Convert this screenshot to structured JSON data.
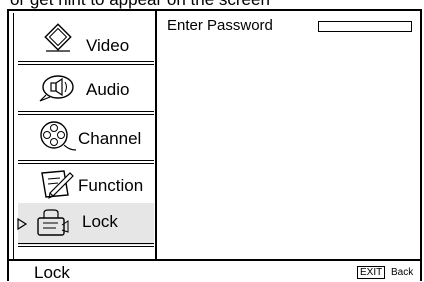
{
  "top_banner": "or get hint to appear on the screen",
  "menu": [
    {
      "label": "Video",
      "icon": "video-diamond-icon",
      "selected": false
    },
    {
      "label": "Audio",
      "icon": "audio-speaker-icon",
      "selected": false
    },
    {
      "label": "Channel",
      "icon": "channel-reel-icon",
      "selected": false
    },
    {
      "label": "Function",
      "icon": "function-pen-icon",
      "selected": false
    },
    {
      "label": "Lock",
      "icon": "lock-hand-icon",
      "selected": true
    }
  ],
  "content": {
    "password_label": "Enter Password",
    "password_value": ""
  },
  "footer": {
    "title": "Lock",
    "exit_key": "EXIT",
    "exit_label": "Back"
  }
}
